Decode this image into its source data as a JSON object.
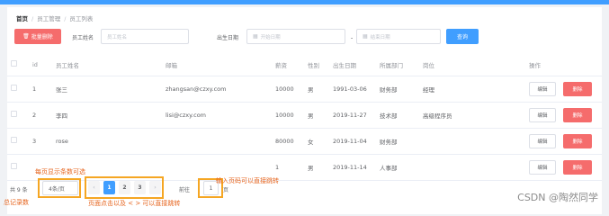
{
  "breadcrumb": {
    "home": "首页",
    "level1": "员工管理",
    "level2": "员工列表"
  },
  "toolbar": {
    "batch_delete": "批量删除",
    "name_label": "员工姓名",
    "name_placeholder": "员工姓名",
    "date_label": "出生日期",
    "start_placeholder": "开始日期",
    "end_placeholder": "结束日期",
    "date_separator": "-",
    "query": "查询"
  },
  "table": {
    "headers": [
      "id",
      "员工姓名",
      "邮箱",
      "薪资",
      "性别",
      "出生日期",
      "所属部门",
      "岗位",
      "操作"
    ],
    "rows": [
      {
        "id": "1",
        "name": "张三",
        "email": "zhangsan@czxy.com",
        "salary": "10000",
        "gender": "男",
        "birth": "1991-03-06",
        "dept": "财务部",
        "post": "经理"
      },
      {
        "id": "2",
        "name": "李四",
        "email": "lisi@czxy.com",
        "salary": "10000",
        "gender": "男",
        "birth": "2019-11-27",
        "dept": "技术部",
        "post": "高级程序员"
      },
      {
        "id": "3",
        "name": "rose",
        "email": "",
        "salary": "80000",
        "gender": "女",
        "birth": "2019-11-04",
        "dept": "财务部",
        "post": ""
      },
      {
        "id": "",
        "name": "",
        "email": "",
        "salary": "1",
        "gender": "男",
        "birth": "2019-11-14",
        "dept": "人事部",
        "post": ""
      }
    ],
    "edit_label": "编辑",
    "delete_label": "删除"
  },
  "pagination": {
    "total": "共 9 条",
    "page_size": "4条/页",
    "prev": "‹",
    "pages": [
      "1",
      "2",
      "3"
    ],
    "next": "›",
    "goto_prefix": "前往",
    "goto_value": "1",
    "goto_suffix": "页"
  },
  "annotations": {
    "page_size_note": "每页显示条数可选",
    "total_note": "总记录数",
    "pager_note": "页面点击以及 < > 可以直接跳转",
    "jump_note": "输入页码可以直接跳转"
  },
  "watermark": "CSDN @陶然同学",
  "colors": {
    "primary": "#409eff",
    "danger": "#f56c6c",
    "annotation": "#f5a623"
  }
}
